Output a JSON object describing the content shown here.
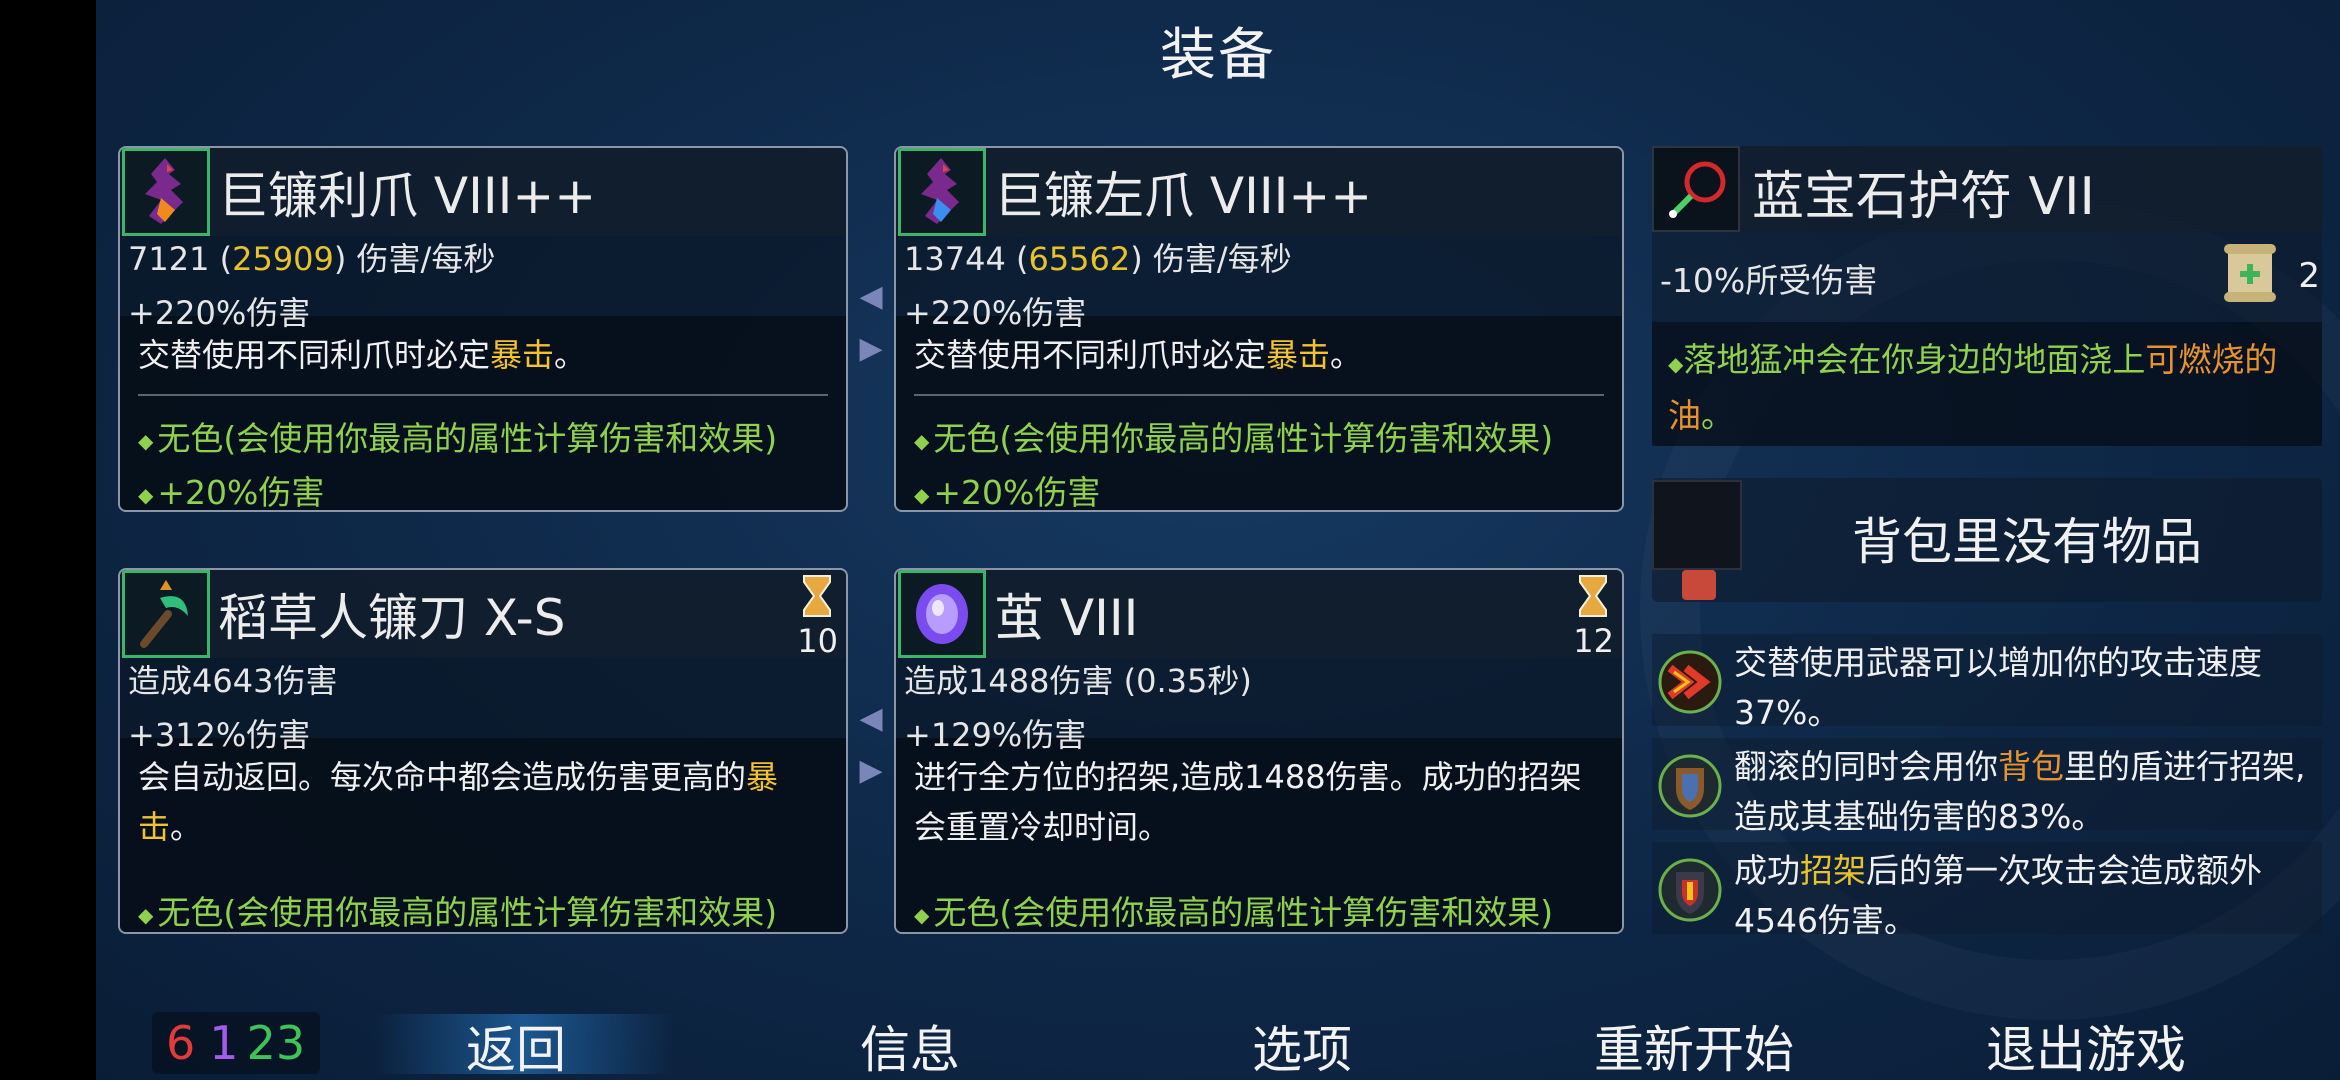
{
  "header": {
    "title": "装备"
  },
  "weapons": [
    {
      "name": "巨镰利爪 VIII++",
      "dps_base": "7121",
      "dps_crit": "25909",
      "dps_unit": "伤害/每秒",
      "bonus": "+220%伤害",
      "desc_pre": "交替使用不同利爪时必定",
      "desc_hl": "暴击",
      "desc_post": "。",
      "affix1": "无色(会使用你最高的属性计算伤害和效果)",
      "affix2": "+20%伤害"
    },
    {
      "name": "巨镰左爪 VIII++",
      "dps_base": "13744",
      "dps_crit": "65562",
      "dps_unit": "伤害/每秒",
      "bonus": "+220%伤害",
      "desc_pre": "交替使用不同利爪时必定",
      "desc_hl": "暴击",
      "desc_post": "。",
      "affix1": "无色(会使用你最高的属性计算伤害和效果)",
      "affix2": "+20%伤害"
    }
  ],
  "skills": [
    {
      "name": "稻草人镰刀 X-S",
      "cooldown": "10",
      "damage": "造成4643伤害",
      "bonus": "+312%伤害",
      "desc_pre": "会自动返回。每次命中都会造成伤害更高的",
      "desc_hl": "暴击",
      "desc_post": "。",
      "affix1": "无色(会使用你最高的属性计算伤害和效果)"
    },
    {
      "name": "茧 VIII",
      "cooldown": "12",
      "damage": "造成1488伤害 (0.35秒)",
      "bonus": "+129%伤害",
      "desc": "进行全方位的招架,造成1488伤害。成功的招架会重置冷却时间。",
      "affix1": "无色(会使用你最高的属性计算伤害和效果)"
    }
  ],
  "amulet": {
    "name": "蓝宝石护符 VII",
    "stat": "-10%所受伤害",
    "scroll_count": "2",
    "text_pre": "落地猛冲会在你身边的地面浇上",
    "text_hl": "可燃烧的油",
    "text_post": "。"
  },
  "backpack": {
    "text": "背包里没有物品"
  },
  "perks": [
    {
      "text": "交替使用武器可以增加你的攻击速度37%。"
    },
    {
      "pre": "翻滚的同时会用你",
      "hl": "背包",
      "post": "里的盾进行招架,造成其基础伤害的83%。"
    },
    {
      "pre": "成功",
      "hl": "招架",
      "post": "后的第一次攻击会造成额外4546伤害。"
    }
  ],
  "scrolls": {
    "brutality": "6",
    "tactics": "1",
    "survival": "23"
  },
  "colors": {
    "brutality": "#e23b3b",
    "tactics": "#a25de8",
    "survival": "#3ec35a",
    "affix_green": "#8fd14f",
    "crit_yellow": "#f3c232",
    "highlight_orange": "#e7922e"
  },
  "nav": {
    "back": "返回",
    "info": "信息",
    "options": "选项",
    "restart": "重新开始",
    "quit": "退出游戏"
  }
}
